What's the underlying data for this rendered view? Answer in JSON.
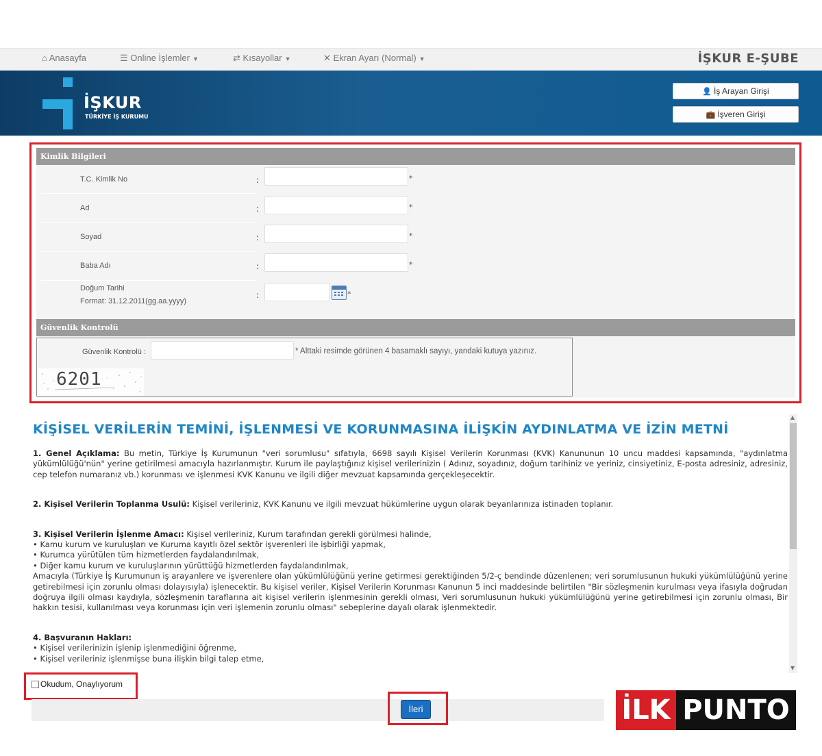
{
  "topnav": {
    "home": "Anasayfa",
    "online": "Online İşlemler",
    "shortcuts": "Kısayollar",
    "screen": "Ekran Ayarı (Normal)",
    "brand": "İŞKUR E-ŞUBE"
  },
  "header": {
    "logo_text": "İŞKUR",
    "logo_sub": "TÜRKİYE İŞ KURUMU",
    "job_seeker_login": "İş Arayan Girişi",
    "employer_login": "İşveren Girişi"
  },
  "identity": {
    "section_title": "Kimlik Bilgileri",
    "fields": [
      {
        "label": "T.C. Kimlik No",
        "value": ""
      },
      {
        "label": "Ad",
        "value": ""
      },
      {
        "label": "Soyad",
        "value": ""
      },
      {
        "label": "Baba Adı",
        "value": ""
      },
      {
        "label": "Doğum Tarihi",
        "value": ""
      }
    ],
    "birth_format": "Format: 31.12.2011(gg.aa.yyyy)",
    "colon": ":",
    "required_mark": "*"
  },
  "security": {
    "section_title": "Güvenlik Kontrolü",
    "label": "Güvenlik Kontrolü :",
    "value": "",
    "hint": "* Alttaki resimde görünen 4 basamaklı sayıyı, yandaki kutuya yazınız.",
    "captcha": "6201"
  },
  "kvkk": {
    "title": "KİŞİSEL VERİLERİN TEMİNİ, İŞLENMESİ VE KORUNMASINA İLİŞKİN AYDINLATMA VE İZİN METNİ",
    "s1_head": "1. Genel Açıklama:",
    "s1_text": " Bu metin, Türkiye İş Kurumunun \"veri sorumlusu\" sıfatıyla, 6698 sayılı Kişisel Verilerin Korunması (KVK) Kanununun 10 uncu maddesi kapsamında, \"aydınlatma yükümlülüğü'nün\" yerine getirilmesi amacıyla hazırlanmıştır. Kurum ile paylaştığınız kişisel verilerinizin ( Adınız, soyadınız, doğum tarihiniz ve yeriniz, cinsiyetiniz, E-posta adresiniz, adresiniz, cep telefon numaranız vb.) korunması ve işlenmesi KVK Kanunu ve ilgili diğer mevzuat kapsamında gerçekleşecektir.",
    "s2_head": "2. Kişisel Verilerin Toplanma Usulü:",
    "s2_text": " Kişisel verileriniz, KVK Kanunu ve ilgili mevzuat hükümlerine uygun olarak beyanlarınıza istinaden toplanır.",
    "s3_head": "3. Kişisel Verilerin İşlenme Amacı:",
    "s3_text": " Kişisel verileriniz, Kurum tarafından gerekli görülmesi halinde,",
    "s3_b1": "• Kamu kurum ve kuruluşları ve Kuruma kayıtlı özel sektör işverenleri ile işbirliği yapmak,",
    "s3_b2": "• Kurumca yürütülen tüm hizmetlerden faydalandırılmak,",
    "s3_b3": "• Diğer kamu kurum ve kuruluşlarının yürüttüğü hizmetlerden faydalandırılmak,",
    "s3_tail": "Amacıyla (Türkiye İş Kurumunun iş arayanlere ve işverenlere olan yükümlülüğünü yerine getirmesi gerektiğinden 5/2-ç bendinde düzenlenen; veri sorumlusunun hukuki yükümlülüğünü yerine getirebilmesi için zorunlu olması dolayısıyla) işlenecektir. Bu kişisel veriler, Kişisel Verilerin Korunması Kanunun 5 inci maddesinde belirtilen \"Bir sözleşmenin kurulması veya ifasıyla doğrudan doğruya ilgili olması kaydıyla, sözleşmenin taraflarına ait kişisel verilerin işlenmesinin gerekli olması, Veri sorumlusunun hukuki yükümlülüğünü yerine getirebilmesi için zorunlu olması, Bir hakkın tesisi, kullanılması veya korunması için veri işlemenin zorunlu olması\" sebeplerine dayalı olarak işlenmektedir.",
    "s4_head": "4. Başvuranın Hakları:",
    "s4_b1": "• Kişisel verilerinizin işlenip işlenmediğini öğrenme,",
    "s4_b2": "• Kişisel verileriniz işlenmişse buna ilişkin bilgi talep etme,"
  },
  "consent_label": "Okudum, Onaylıyorum",
  "next_button": "İleri",
  "watermark": {
    "left": "İLK",
    "right": "PUNTO"
  },
  "colors": {
    "header_blue": "#1a5e91",
    "title_blue": "#1f86c7",
    "highlight_red": "#d9202b",
    "button_blue": "#1b6ec2"
  }
}
